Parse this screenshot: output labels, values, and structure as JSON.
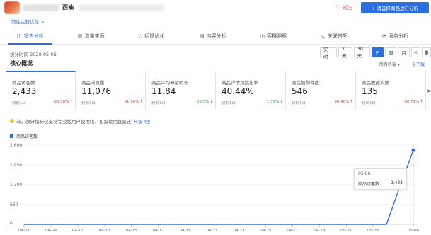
{
  "header": {
    "shop_name": "西柚",
    "follow_label": "关注",
    "select_button_label": "+ 请选择商品进行分析"
  },
  "back_link": "前往主题优化 >",
  "tabs": [
    {
      "icon": "chart-icon",
      "label": "销售分析",
      "active": true
    },
    {
      "icon": "funnel-icon",
      "label": "流量来源",
      "active": false
    },
    {
      "icon": "tag-icon",
      "label": "标题优化",
      "active": false
    },
    {
      "icon": "doc-icon",
      "label": "内容分析",
      "active": false
    },
    {
      "icon": "people-icon",
      "label": "客群洞察",
      "active": false
    },
    {
      "icon": "link-icon",
      "label": "关联搭配",
      "active": false
    },
    {
      "icon": "service-icon",
      "label": "服务分析",
      "active": false
    }
  ],
  "stat_time": "统计时间 2020-05-06",
  "periods": [
    {
      "label": "实 时",
      "selected": false
    },
    {
      "label": "7天",
      "selected": false
    },
    {
      "label": "30天",
      "selected": false
    },
    {
      "label": "日",
      "selected": true
    },
    {
      "label": "周",
      "selected": false
    },
    {
      "label": "月",
      "selected": false
    },
    {
      "label": "<",
      "selected": false
    }
  ],
  "core": {
    "title": "核心概况",
    "right_label": "所有终端 ▾",
    "right_link": "全下载"
  },
  "metrics": [
    {
      "label": "商品访客数",
      "value": "2,433",
      "compare": "较前1日",
      "pct": "95.58%",
      "trend": "up"
    },
    {
      "label": "商品浏览量",
      "value": "11,076",
      "compare": "较前1日",
      "pct": "91.76%",
      "trend": "up"
    },
    {
      "label": "商品平均停留时长",
      "value": "11.84",
      "compare": "较前1日",
      "pct": "0.63%",
      "trend": "down"
    },
    {
      "label": "商品详情页跳出率",
      "value": "40.44%",
      "compare": "较前1日",
      "pct": "1.37%",
      "trend": "down"
    },
    {
      "label": "商品加购件数",
      "value": "546",
      "compare": "较前1日",
      "pct": "96.40%",
      "trend": "up"
    },
    {
      "label": "商品收藏人数",
      "value": "135",
      "compare": "较前1日",
      "pct": "60.71%",
      "trend": "up"
    }
  ],
  "next_arrow": ">",
  "notice": {
    "text": "非，部分指标仅支持专业版用户使用哦，如需使用赶紧去",
    "upgrade": "升级 吧！"
  },
  "tooltip": {
    "date": "05-06",
    "series": "商品访客数",
    "value": "2,433"
  },
  "colors": {
    "accent": "#2a6ee0",
    "up": "#e0463c",
    "down": "#2f9a4b"
  },
  "chart_data": {
    "type": "line",
    "series": [
      {
        "name": "商品访客数",
        "x": [
          "04-07",
          "04-08",
          "04-09",
          "04-10",
          "04-11",
          "04-12",
          "04-13",
          "04-14",
          "04-15",
          "04-16",
          "04-17",
          "04-18",
          "04-19",
          "04-20",
          "04-21",
          "04-22",
          "04-23",
          "04-24",
          "04-25",
          "04-26",
          "04-27",
          "04-28",
          "04-29",
          "04-30",
          "05-01",
          "05-02",
          "05-03",
          "05-04",
          "05-05",
          "05-06"
        ],
        "values": [
          0,
          0,
          0,
          0,
          0,
          0,
          0,
          0,
          0,
          0,
          0,
          0,
          0,
          0,
          0,
          0,
          0,
          0,
          0,
          0,
          0,
          0,
          0,
          0,
          0,
          0,
          0,
          0,
          1244,
          2433
        ]
      }
    ],
    "x_ticks": [
      "04-07",
      "04-09",
      "04-11",
      "04-13",
      "04-15",
      "04-17",
      "04-19",
      "04-21",
      "04-23",
      "04-25",
      "04-27",
      "04-29",
      "05-01",
      "05-03",
      "05-06"
    ],
    "y_ticks": [
      "0",
      "650",
      "1,300",
      "1,950",
      "2,600"
    ],
    "ylim": [
      0,
      2600
    ],
    "grid": true,
    "legend": "top-left"
  }
}
